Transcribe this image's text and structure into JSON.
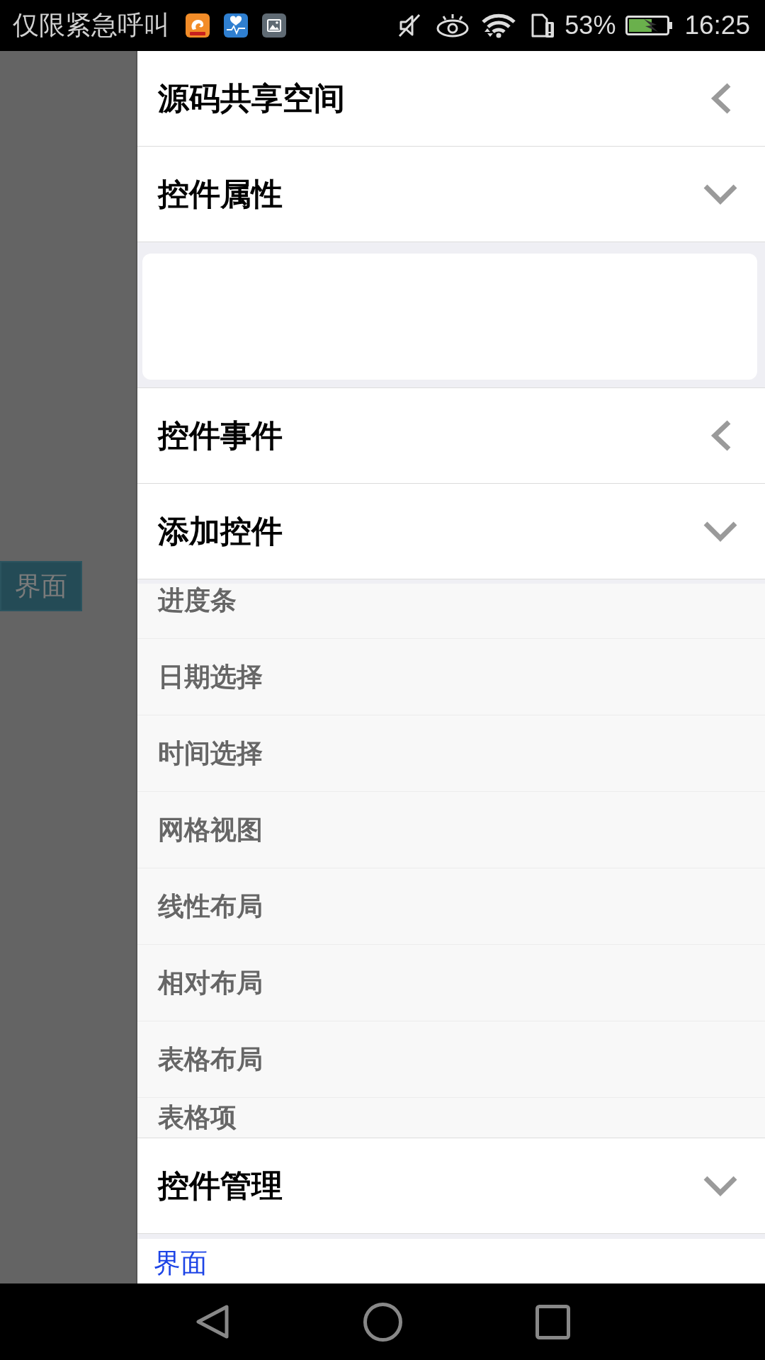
{
  "status_bar": {
    "carrier": "仅限紧急呼叫",
    "battery": "53%",
    "time": "16:25"
  },
  "background": {
    "button": "界面"
  },
  "drawer": {
    "sections": [
      {
        "title": "源码共享空间",
        "expanded": false
      },
      {
        "title": "控件属性",
        "expanded": true,
        "kind": "panel"
      },
      {
        "title": "控件事件",
        "expanded": false
      },
      {
        "title": "添加控件",
        "expanded": true,
        "kind": "list",
        "items": [
          "进度条",
          "日期选择",
          "时间选择",
          "网格视图",
          "线性布局",
          "相对布局",
          "表格布局",
          "表格项"
        ]
      },
      {
        "title": "控件管理",
        "expanded": true,
        "kind": "links",
        "items": [
          "界面"
        ]
      }
    ]
  }
}
